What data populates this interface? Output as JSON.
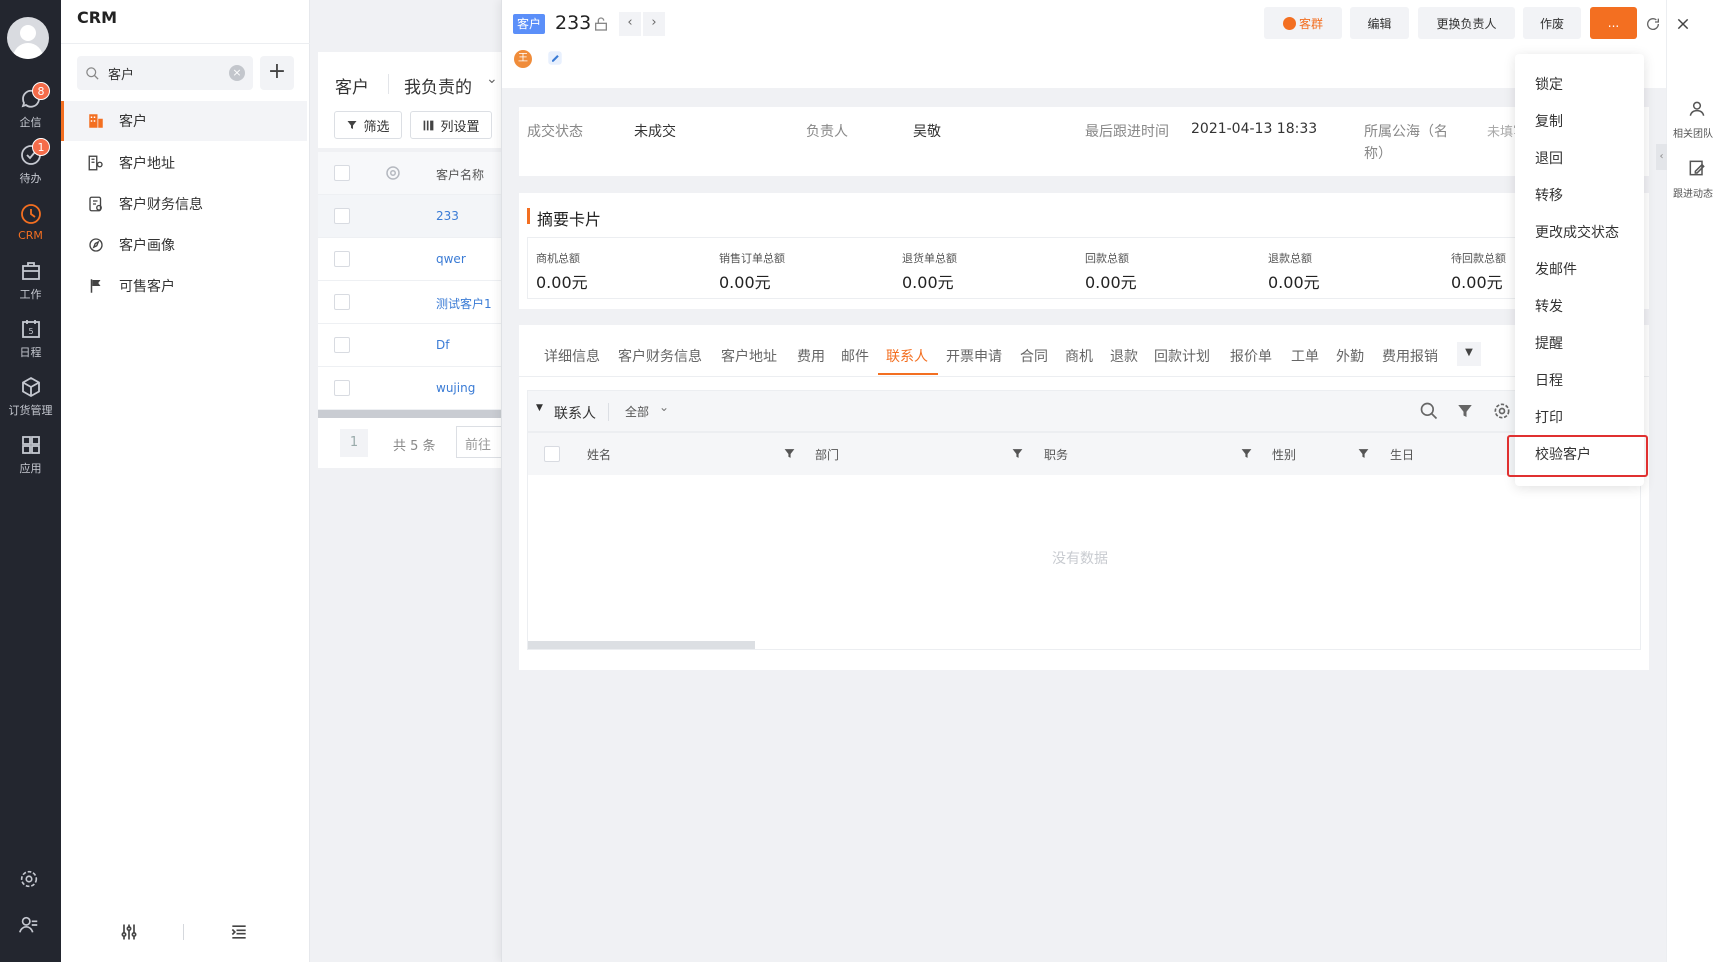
{
  "rail": {
    "items": [
      {
        "label": "企信",
        "badge": "8"
      },
      {
        "label": "待办",
        "badge": "1"
      },
      {
        "label": "CRM"
      },
      {
        "label": "工作"
      },
      {
        "label": "日程"
      },
      {
        "label": "订货管理"
      },
      {
        "label": "应用"
      }
    ]
  },
  "sidebar": {
    "title": "CRM",
    "search_value": "客户",
    "items": [
      "客户",
      "客户地址",
      "客户财务信息",
      "客户画像",
      "可售客户"
    ]
  },
  "list": {
    "object_label": "客户",
    "scope": "我负责的",
    "filter_label": "筛选",
    "columns_label": "列设置",
    "column_name": "客户名称",
    "rows": [
      "233",
      "qwer",
      "测试客户1",
      "Df",
      "wujing"
    ],
    "page": "1",
    "total": "共 5 条",
    "goto": "前往"
  },
  "detail": {
    "tag": "客户",
    "name": "233",
    "avatar_letter": "王",
    "buttons": {
      "group": "客群",
      "edit": "编辑",
      "change_owner": "更换负责人",
      "void": "作废",
      "more": "..."
    },
    "info": [
      {
        "label": "成交状态",
        "value": "未成交"
      },
      {
        "label": "负责人",
        "value": "吴敬"
      },
      {
        "label": "最后跟进时间",
        "value": "2021-04-13 18:33"
      },
      {
        "label": "所属公海（名称）",
        "value": "未填写"
      }
    ],
    "summary_title": "摘要卡片",
    "summary": [
      {
        "label": "商机总额",
        "value": "0.00元"
      },
      {
        "label": "销售订单总额",
        "value": "0.00元"
      },
      {
        "label": "退货单总额",
        "value": "0.00元"
      },
      {
        "label": "回款总额",
        "value": "0.00元"
      },
      {
        "label": "退款总额",
        "value": "0.00元"
      },
      {
        "label": "待回款总额",
        "value": "0.00元"
      }
    ],
    "tabs": [
      "详细信息",
      "客户财务信息",
      "客户地址",
      "费用",
      "邮件",
      "联系人",
      "开票申请",
      "合同",
      "商机",
      "退款",
      "回款计划",
      "报价单",
      "工单",
      "外勤",
      "费用报销"
    ],
    "active_tab": "联系人",
    "sub": {
      "title": "联系人",
      "scope": "全部"
    },
    "table_columns": [
      "姓名",
      "部门",
      "职务",
      "性别",
      "生日"
    ],
    "empty": "没有数据"
  },
  "menu": [
    "锁定",
    "复制",
    "退回",
    "转移",
    "更改成交状态",
    "发邮件",
    "转发",
    "提醒",
    "日程",
    "打印",
    "校验客户"
  ],
  "right_panel": [
    "相关团队",
    "跟进动态"
  ],
  "colors": {
    "accent": "#f36f21",
    "link": "#3a7bd5",
    "highlight_border": "#e03030"
  }
}
